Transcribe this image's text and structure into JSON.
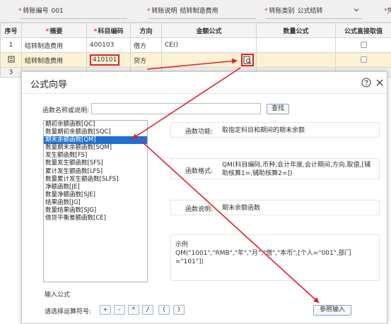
{
  "topbar": {
    "voucher_no_label": "转账编号",
    "voucher_no": "001",
    "desc_label": "转账说明",
    "desc_value": "结转制造费用",
    "type_label": "转账类别",
    "type_value": "公式结转",
    "right_text": "凭"
  },
  "grid": {
    "headers": [
      "序号",
      "摘要",
      "科目编码",
      "方向",
      "金额公式",
      "数量公式",
      "公式直接取值"
    ],
    "rows": [
      {
        "seq": "1",
        "summary": "结转制造费用",
        "code": "400103",
        "dir": "借方",
        "formula": "CE()"
      },
      {
        "seq": "",
        "summary": "结转制造费用",
        "code": "410101",
        "dir": "贷方",
        "formula": ""
      }
    ],
    "extra_seq": "3"
  },
  "dialog": {
    "title": "公式向导",
    "search_label": "函数名称或说明:",
    "search_value": "",
    "search_button": "查找",
    "functions": [
      "期初余额函数[QC]",
      "数量期初余额函数[SQC]",
      "期末余额函数[QM]",
      "数量期末余额函数[SQM]",
      "发生额函数[FS]",
      "数量发生额函数[SFS]",
      "累计发生额函数[LFS]",
      "数量累计发生额函数[SLFS]",
      "净额函数[JE]",
      "数量净额函数[SJE]",
      "结果函数[JG]",
      "数量结果函数[SJG]",
      "借贷平衡差额函数[CE]"
    ],
    "selected_index": 2,
    "func_purpose_label": "函数功能:",
    "func_purpose": "取指定科目和期间的期末余额",
    "func_format_label": "函数格式:",
    "func_format": "QM(科目编码,币种,会计年度,会计期间,方向,取值,[辅助核算1=,辅助核算2=])",
    "func_desc_label": "函数说明:",
    "func_desc": "期末余额函数",
    "example_label": "示例",
    "example": "QM(\"1001\",\"RMB\",\"年\",\"月\",\"借\",\"本币\",[个人=\"001\",部门=\"101\"])",
    "input_formula_label": "输入公式",
    "operator_label": "请选择运算符号:",
    "operators": [
      "+",
      "-",
      "*",
      "/",
      "(",
      ")"
    ],
    "ref_input_button": "参照输入"
  },
  "colors": {
    "highlight_red": "#e0202a",
    "selected_blue": "#1f6fd3",
    "selected_row": "#fbf2d3"
  }
}
